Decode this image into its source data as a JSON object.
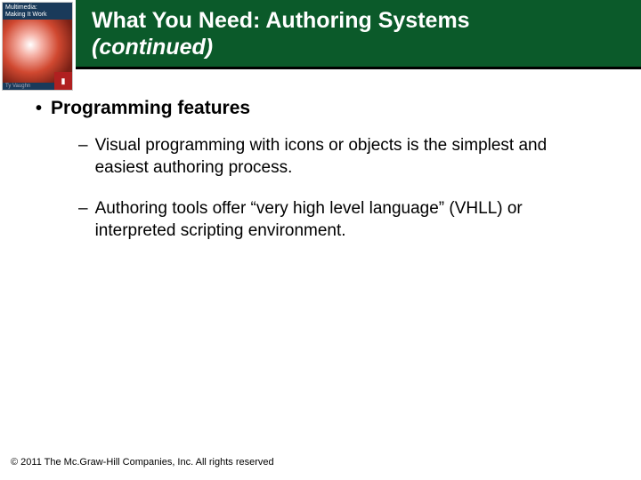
{
  "book_cover": {
    "title_top1": "Multimedia:",
    "title_top2": "Making It Work",
    "author": "Ty Vaughn"
  },
  "header": {
    "title_line1": "What You Need: Authoring Systems",
    "title_line2": "(continued)"
  },
  "content": {
    "bullet_label": "Programming features",
    "items": [
      "Visual programming with icons or objects is the simplest and easiest authoring process.",
      "Authoring tools offer “very high level language” (VHLL) or interpreted scripting environment."
    ]
  },
  "footer": {
    "copyright": "© 2011 The Mc.Graw-Hill Companies, Inc. All rights reserved"
  }
}
